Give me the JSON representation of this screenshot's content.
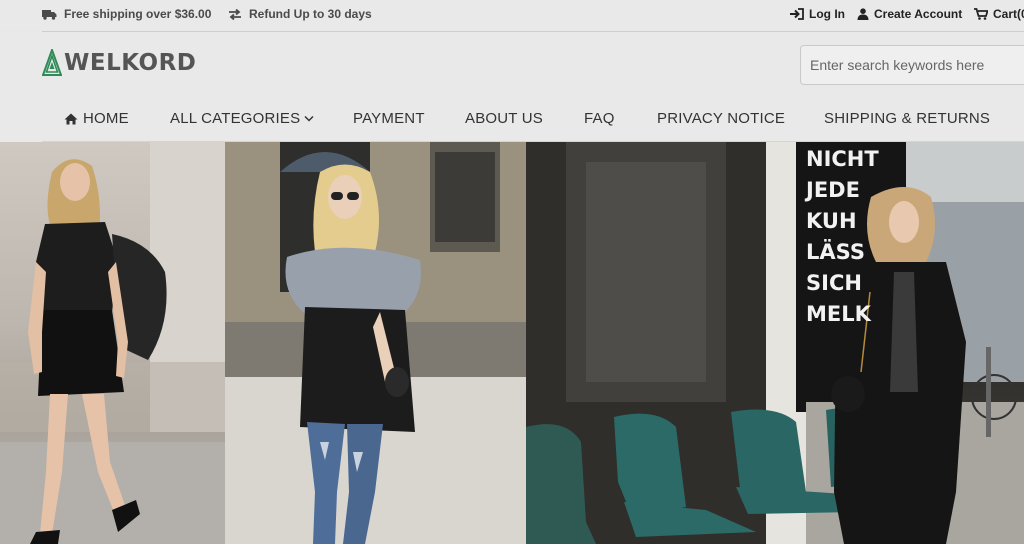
{
  "topbar": {
    "shipping_text": "Free shipping over $36.00",
    "refund_text": "Refund Up to 30 days",
    "login_label": "Log In",
    "create_account_label": "Create Account",
    "cart_label": "Cart(0"
  },
  "header": {
    "logo_text": "WELKORD",
    "search_placeholder": "Enter search keywords here"
  },
  "nav": {
    "home": "HOME",
    "categories": "ALL CATEGORIES",
    "payment": "PAYMENT",
    "about": "ABOUT US",
    "faq": "FAQ",
    "privacy": "PRIVACY NOTICE",
    "shipping": "SHIPPING & RETURNS"
  },
  "hero": {
    "sign_text": "NICHT\nJEDE\nKUH\nLÄSS\nSICH\nMELK"
  },
  "colors": {
    "topbar_bg": "#e9e9e9",
    "logo_green": "#2e8b57",
    "text_dark": "#333333"
  }
}
